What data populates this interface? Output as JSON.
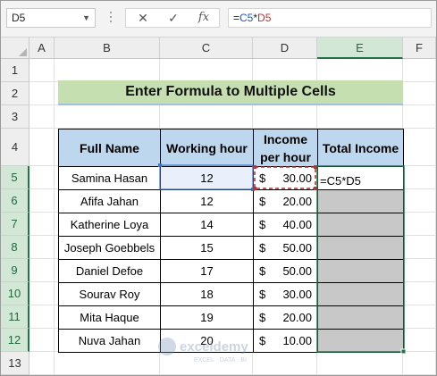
{
  "formula_bar": {
    "name_box": "D5",
    "cancel_icon": "✕",
    "enter_icon": "✓",
    "fx_label": "fx",
    "formula_prefix": "=",
    "formula_ref1": "C5",
    "formula_op": "*",
    "formula_ref2": "D5"
  },
  "columns": [
    "A",
    "B",
    "C",
    "D",
    "E",
    "F"
  ],
  "rows": [
    "1",
    "2",
    "3",
    "4",
    "5",
    "6",
    "7",
    "8",
    "9",
    "10",
    "11",
    "12",
    "13"
  ],
  "sheet": {
    "title": "Enter Formula to Multiple Cells",
    "headers": {
      "name": "Full Name",
      "hours": "Working hour",
      "rate_line1": "Income",
      "rate_line2": "per hour",
      "total": "Total Income"
    },
    "currency": "$",
    "editing_formula": "=C5*D5",
    "records": [
      {
        "name": "Samina Hasan",
        "hours": "12",
        "rate": "30.00"
      },
      {
        "name": "Afifa Jahan",
        "hours": "12",
        "rate": "20.00"
      },
      {
        "name": "Katherine Loya",
        "hours": "14",
        "rate": "40.00"
      },
      {
        "name": "Joseph Goebbels",
        "hours": "15",
        "rate": "50.00"
      },
      {
        "name": "Daniel Defoe",
        "hours": "17",
        "rate": "50.00"
      },
      {
        "name": "Sourav Roy",
        "hours": "18",
        "rate": "30.00"
      },
      {
        "name": "Mita Haque",
        "hours": "19",
        "rate": "20.00"
      },
      {
        "name": "Nuva Jahan",
        "hours": "20",
        "rate": "10.00"
      }
    ]
  },
  "watermark": {
    "brand": "exceldemy",
    "tagline": "EXCEL · DATA · BI"
  },
  "colors": {
    "title_fill": "#c5dfb0",
    "header_fill": "#bdd7ee",
    "selection": "#217346",
    "ref_c5": "#1a56c8",
    "ref_d5": "#c03030"
  }
}
